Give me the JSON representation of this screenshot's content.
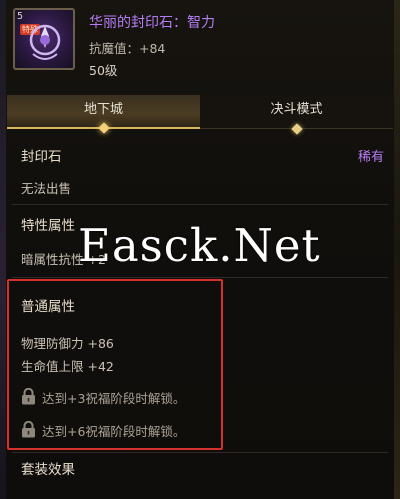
{
  "item": {
    "grade_badge": "5",
    "tag": "特殊",
    "name": "华丽的封印石：智力",
    "stat": "抗魔值：+84",
    "level": "50级"
  },
  "tabs": [
    {
      "label": "地下城",
      "active": true
    },
    {
      "label": "决斗模式",
      "active": false
    }
  ],
  "type_section": {
    "title": "封印石",
    "rarity": "稀有",
    "rarity_color": "#b57cf5",
    "note": "无法出售"
  },
  "special_section": {
    "title": "特性属性",
    "line": "暗属性抗性 +2"
  },
  "common_section": {
    "title": "普通属性",
    "stats": [
      "物理防御力 +86",
      "生命值上限 +42"
    ],
    "locked": [
      {
        "icon": "padlock-icon",
        "text": "达到+3祝福阶段时解锁。"
      },
      {
        "icon": "padlock-icon",
        "text": "达到+6祝福阶段时解锁。"
      }
    ]
  },
  "set_section": {
    "title": "套装效果"
  },
  "watermark": "Easck.Net",
  "colors": {
    "accent_purple": "#b57cf5",
    "tab_highlight": "#d8b45a",
    "highlight_box": "#d6302a"
  }
}
